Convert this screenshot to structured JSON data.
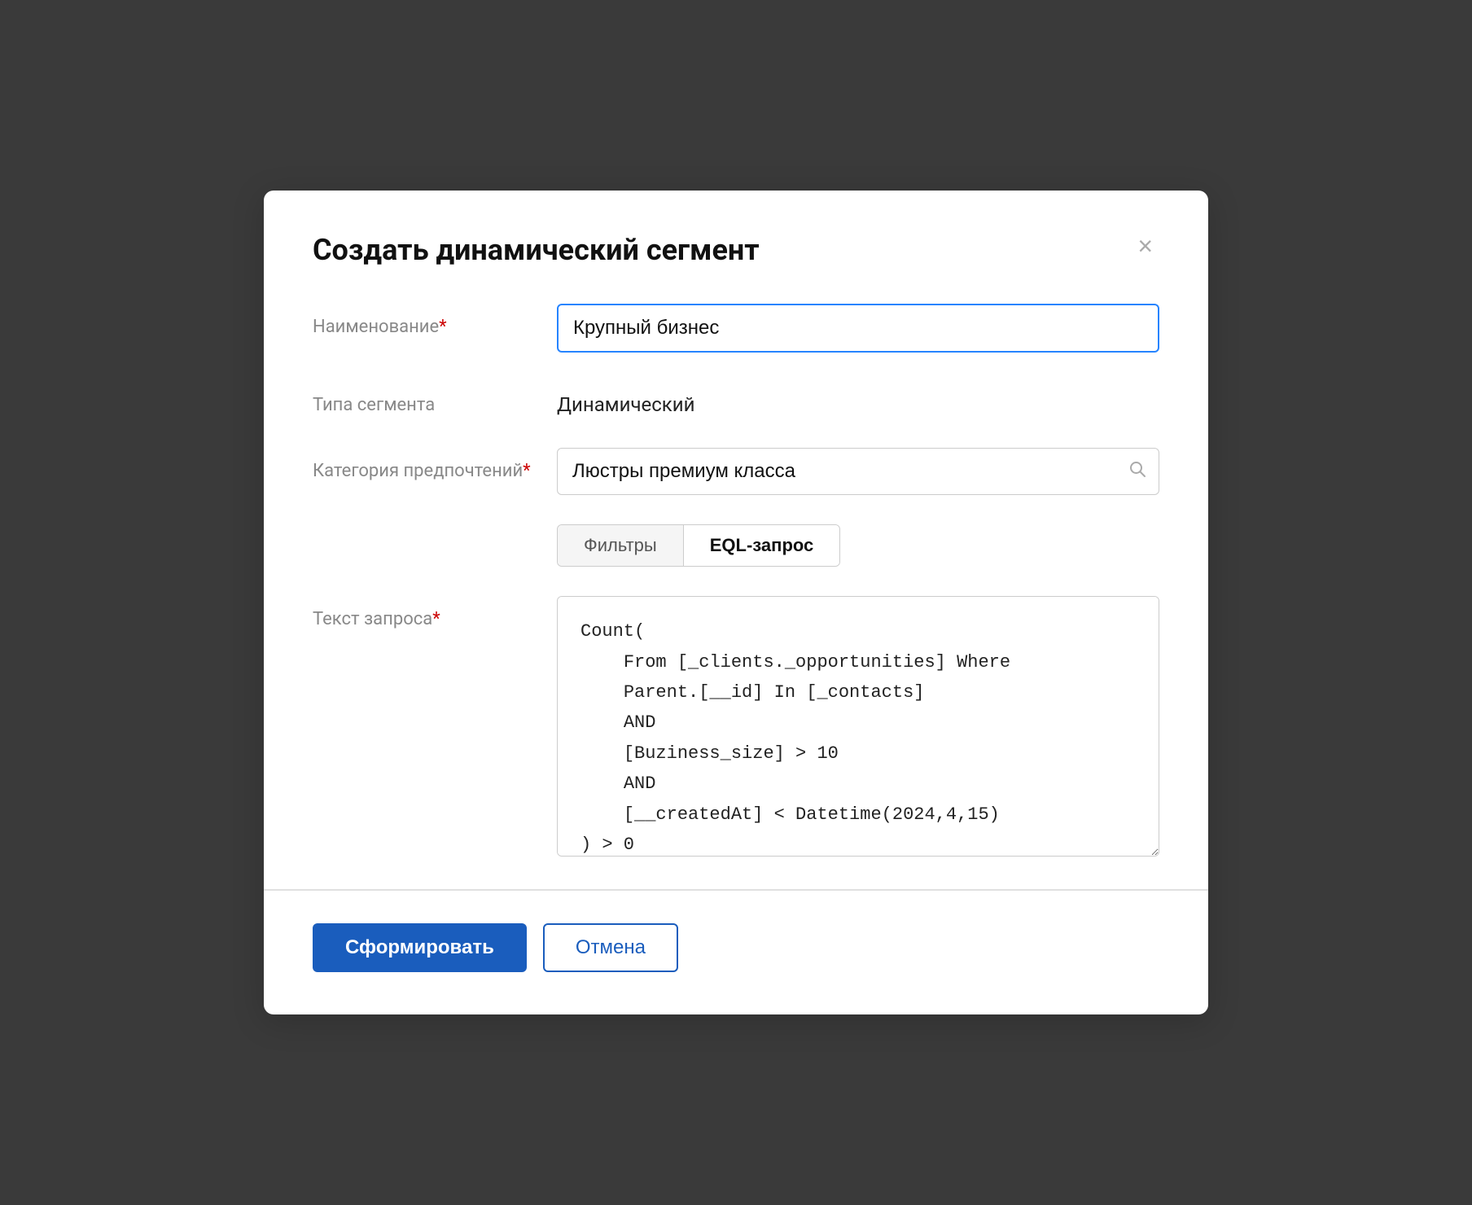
{
  "modal": {
    "title": "Создать динамический сегмент",
    "close_label": "×"
  },
  "form": {
    "name_label": "Наименование",
    "name_required": "*",
    "name_value": "Крупный бизнес",
    "segment_type_label": "Типа сегмента",
    "segment_type_value": "Динамический",
    "category_label": "Категория предпочтений",
    "category_required": "*",
    "category_value": "Люстры премиум класса",
    "category_placeholder": "Люстры премиум класса",
    "tab_filters_label": "Фильтры",
    "tab_eql_label": "EQL-запрос",
    "query_label": "Текст запроса",
    "query_required": "*",
    "query_value": "Count(\n    From [_clients._opportunities] Where\n    Parent.[__id] In [_contacts]\n    AND\n    [Buziness_size] > 10\n    AND\n    [__createdAt] < Datetime(2024,4,15)\n) > 0"
  },
  "footer": {
    "submit_label": "Сформировать",
    "cancel_label": "Отмена"
  },
  "icons": {
    "search": "🔍",
    "close": "×"
  }
}
